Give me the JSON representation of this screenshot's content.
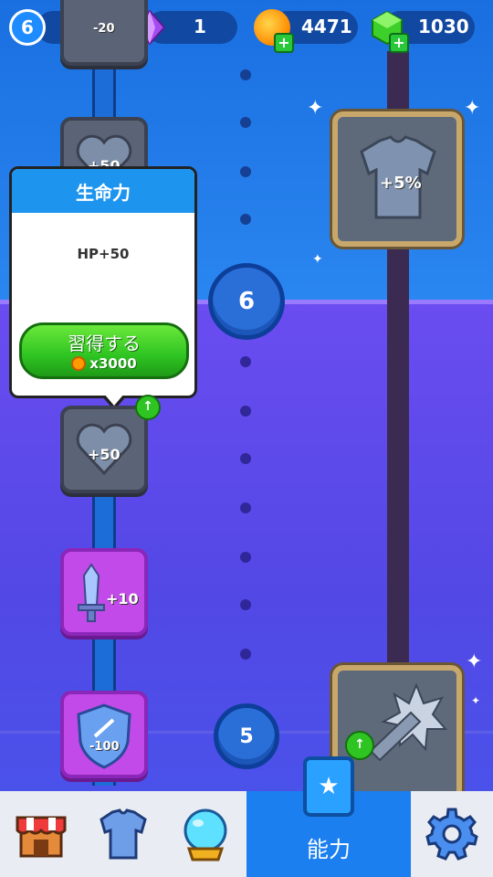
{
  "hud": {
    "level": "6",
    "gems": "1",
    "coins": "4471",
    "cubes": "1030",
    "top_node_text": "-20"
  },
  "nodes": {
    "hp_top": "+50",
    "hp_selected": "+50",
    "sword": "+10",
    "shield": "-100",
    "armor": "+5%"
  },
  "levels": {
    "current": "6",
    "next": "5"
  },
  "tooltip": {
    "title": "生命力",
    "description": "HP+50",
    "button_label": "習得する",
    "cost": "x3000"
  },
  "nav": {
    "active_label": "能力",
    "items": [
      "shop-icon",
      "armor-icon",
      "crystal-ball-icon",
      "star-card-icon",
      "gear-icon"
    ]
  },
  "colors": {
    "accent": "#1b7ff0",
    "button_green": "#2ec422",
    "tooltip_header": "#1d95ef"
  }
}
